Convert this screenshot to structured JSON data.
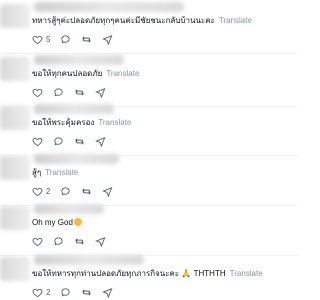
{
  "translate_label": "Translate",
  "replies": [
    {
      "text": "ทหารสู้ๆค่ะปลอดภัยทุกๆคนค่ะมีชัยชนะกลับบ้านนะคะ",
      "emoji": "",
      "reply_count": "5",
      "show_share": false
    },
    {
      "text": "ขอให้ทุกคนปลอดภัย",
      "emoji": "",
      "reply_count": "",
      "show_share": true
    },
    {
      "text": "ขอให้พระคุ้มครอง",
      "emoji": "",
      "reply_count": "",
      "show_share": true
    },
    {
      "text": "สู้ๆ",
      "emoji": "",
      "reply_count": "2",
      "show_share": true
    },
    {
      "text": "Oh my God",
      "emoji": "smile",
      "reply_count": "",
      "show_share": true
    },
    {
      "text": "ขอให้ทหารทุกท่านปลอดภัยทุกภารกิจนะคะ 🙏 THTHTH",
      "emoji": "",
      "reply_count": "2",
      "show_share": true
    }
  ]
}
